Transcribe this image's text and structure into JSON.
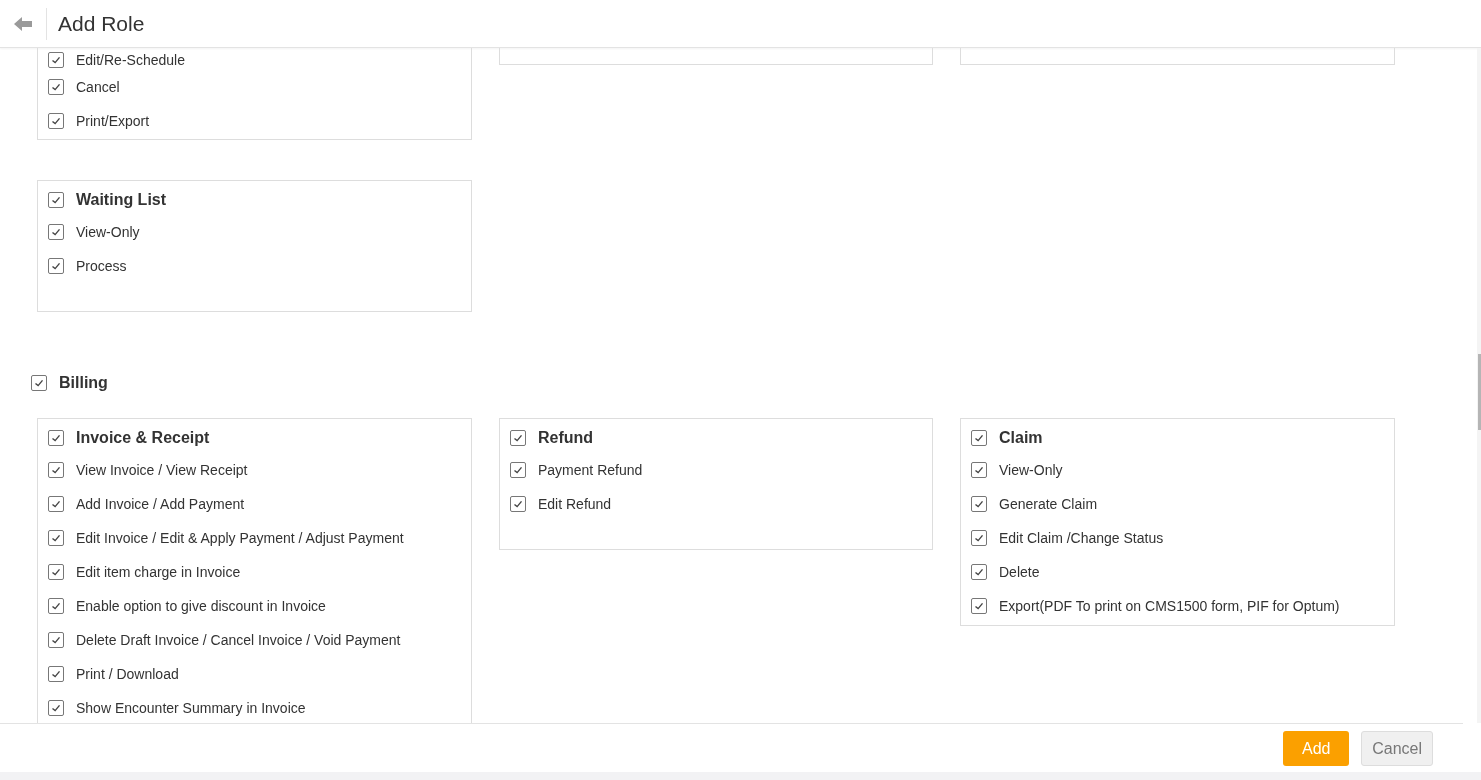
{
  "header": {
    "title": "Add Role"
  },
  "continued_panels": [
    {
      "kind": "list",
      "items": [
        {
          "label": "Edit/Re-Schedule",
          "checked": true
        },
        {
          "label": "Cancel",
          "checked": true
        },
        {
          "label": "Print/Export",
          "checked": true
        }
      ]
    },
    {
      "kind": "blank"
    },
    {
      "kind": "blank"
    }
  ],
  "waiting_list": {
    "title": "Waiting List",
    "checked": true,
    "items": [
      {
        "label": "View-Only",
        "checked": true
      },
      {
        "label": "Process",
        "checked": true
      }
    ]
  },
  "billing": {
    "label": "Billing",
    "checked": true,
    "panels": [
      {
        "title": "Invoice & Receipt",
        "checked": true,
        "items": [
          {
            "label": "View Invoice / View Receipt",
            "checked": true
          },
          {
            "label": "Add Invoice / Add Payment",
            "checked": true
          },
          {
            "label": "Edit Invoice / Edit & Apply Payment / Adjust Payment",
            "checked": true
          },
          {
            "label": "Edit item charge in Invoice",
            "checked": true
          },
          {
            "label": "Enable option to give discount in Invoice",
            "checked": true
          },
          {
            "label": "Delete Draft Invoice / Cancel Invoice / Void Payment",
            "checked": true
          },
          {
            "label": "Print / Download",
            "checked": true
          },
          {
            "label": "Show Encounter Summary in Invoice",
            "checked": true
          }
        ]
      },
      {
        "title": "Refund",
        "checked": true,
        "items": [
          {
            "label": "Payment Refund",
            "checked": true
          },
          {
            "label": "Edit Refund",
            "checked": true
          }
        ]
      },
      {
        "title": "Claim",
        "checked": true,
        "items": [
          {
            "label": "View-Only",
            "checked": true
          },
          {
            "label": "Generate Claim",
            "checked": true
          },
          {
            "label": "Edit Claim /Change Status",
            "checked": true
          },
          {
            "label": "Delete",
            "checked": true
          },
          {
            "label": "Export(PDF To print on CMS1500 form, PIF for Optum)",
            "checked": true
          }
        ]
      }
    ]
  },
  "footer": {
    "buttons": [
      {
        "label": "Add",
        "kind": "primary"
      },
      {
        "label": "Cancel",
        "kind": "secondary"
      }
    ]
  }
}
